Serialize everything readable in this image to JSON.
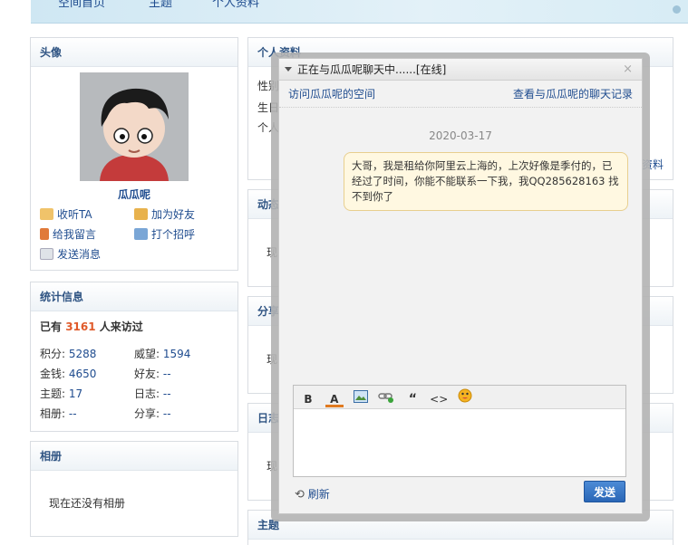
{
  "nav": {
    "items": [
      "空间首页",
      "主题",
      "个人资料"
    ]
  },
  "avatar_panel": {
    "title": "头像",
    "username": "瓜瓜呢",
    "actions": [
      {
        "label": "收听TA"
      },
      {
        "label": "加为好友"
      },
      {
        "label": "给我留言"
      },
      {
        "label": "打个招呼"
      },
      {
        "label": "发送消息"
      }
    ]
  },
  "stats": {
    "title": "统计信息",
    "visitors_prefix": "已有",
    "visitors_count": "3161",
    "visitors_suffix": "人来访过",
    "items": [
      {
        "label": "积分:",
        "value": "5288"
      },
      {
        "label": "威望:",
        "value": "1594"
      },
      {
        "label": "金钱:",
        "value": "4650"
      },
      {
        "label": "好友:",
        "value": "--"
      },
      {
        "label": "主题:",
        "value": "17"
      },
      {
        "label": "日志:",
        "value": "--"
      },
      {
        "label": "相册:",
        "value": "--"
      },
      {
        "label": "分享:",
        "value": "--"
      }
    ]
  },
  "album": {
    "title": "相册",
    "empty_text": "现在还没有相册"
  },
  "profile": {
    "title": "个人资料",
    "lines": [
      "性别",
      "生日",
      "个人"
    ],
    "more": "资料"
  },
  "sections": [
    {
      "title": "动态",
      "text": "现"
    },
    {
      "title": "分享",
      "text": "现"
    },
    {
      "title": "日志",
      "text": "现"
    },
    {
      "title": "主题",
      "text": ""
    }
  ],
  "chat": {
    "title": "正在与瓜瓜呢聊天中......[在线]",
    "close": "×",
    "visit_link": "访问瓜瓜呢的空间",
    "history_link": "查看与瓜瓜呢的聊天记录",
    "date": "2020-03-17",
    "message": "大哥，我是租给你阿里云上海的，上次好像是季付的，已经过了时间，你能不能联系一下我，我QQ285628163  找不到你了",
    "toolbar": {
      "bold": "B",
      "color": "A",
      "quote": "“",
      "code": "<>"
    },
    "refresh": "刷新",
    "send": "发送"
  },
  "colors": {
    "link": "#1f4c8f",
    "accent": "#e05a2a",
    "send_button": "#2a66b6"
  }
}
